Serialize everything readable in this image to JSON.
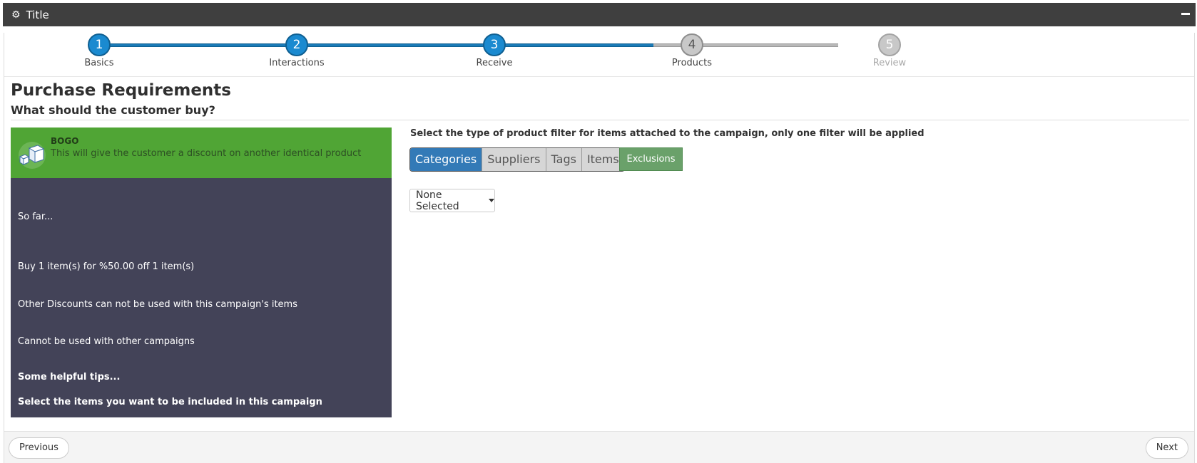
{
  "window": {
    "title": "Title"
  },
  "wizard": {
    "steps": [
      {
        "number": "1",
        "label": "Basics"
      },
      {
        "number": "2",
        "label": "Interactions"
      },
      {
        "number": "3",
        "label": "Receive"
      },
      {
        "number": "4",
        "label": "Products"
      },
      {
        "number": "5",
        "label": "Review"
      }
    ],
    "current_step": 4,
    "colors": {
      "done": "#1a8ad0",
      "todo": "#c8c8c8"
    }
  },
  "page": {
    "title": "Purchase Requirements",
    "subtitle": "What should the customer buy?"
  },
  "campaign_type": {
    "title": "BOGO",
    "description": "This will give the customer a discount on another identical product",
    "icon": "boxes-icon",
    "color": "#50a535"
  },
  "summary": {
    "heading": "So far...",
    "lines": [
      "Buy 1 item(s) for %50.00 off 1 item(s)",
      "Other Discounts can not be used with this campaign's items",
      "Cannot be used with other campaigns"
    ],
    "tips_heading": "Some helpful tips...",
    "tip": "Select the items you want to be included in this campaign",
    "color": "#434358"
  },
  "filter": {
    "instruction": "Select the type of product filter for items attached to the campaign, only one filter will be applied",
    "options": [
      "Categories",
      "Suppliers",
      "Tags",
      "Items"
    ],
    "selected": "Categories",
    "exclusions_label": "Exclusions",
    "dropdown_value": "None Selected"
  },
  "footer": {
    "previous_label": "Previous",
    "next_label": "Next"
  }
}
